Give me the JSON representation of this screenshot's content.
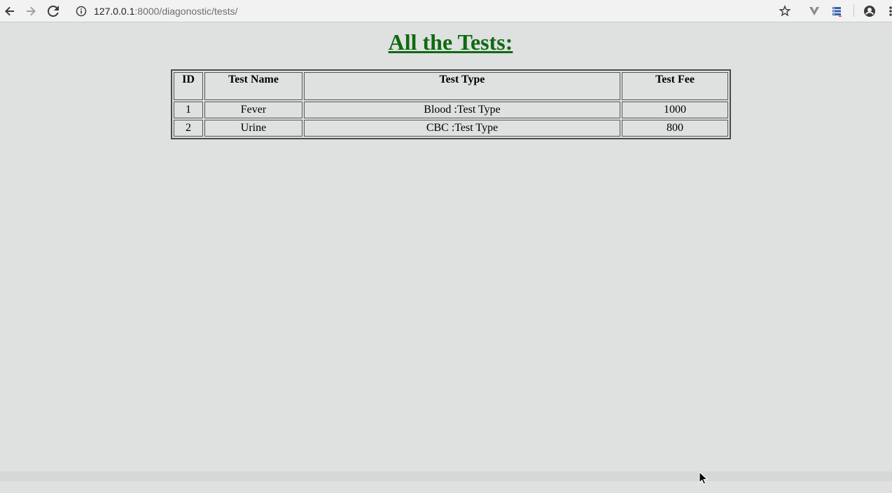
{
  "browser": {
    "url_host": "127.0.0.1",
    "url_path": ":8000/diagonostic/tests/"
  },
  "page": {
    "title": "All the Tests:"
  },
  "table": {
    "headers": [
      "ID",
      "Test Name",
      "Test Type",
      "Test Fee"
    ],
    "rows": [
      [
        "1",
        "Fever",
        "Blood :Test Type",
        "1000"
      ],
      [
        "2",
        "Urine",
        "CBC :Test Type",
        "800"
      ]
    ]
  },
  "colors": {
    "title": "#0f6a12",
    "background": "#dfe0e0"
  }
}
